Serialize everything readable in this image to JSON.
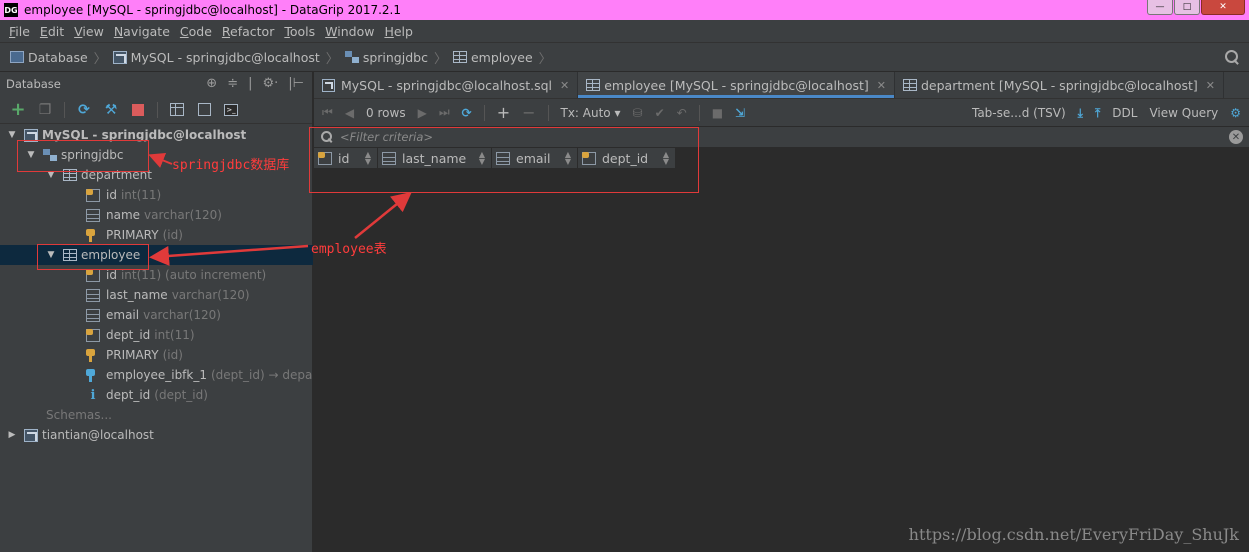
{
  "window": {
    "app_icon": "DG",
    "title": "employee [MySQL - springjdbc@localhost] - DataGrip 2017.2.1",
    "buttons": {
      "minimize": "—",
      "maximize": "□",
      "close": "✕"
    }
  },
  "menu": [
    {
      "key": "F",
      "rest": "ile"
    },
    {
      "key": "E",
      "rest": "dit"
    },
    {
      "key": "V",
      "rest": "iew"
    },
    {
      "key": "N",
      "rest": "avigate"
    },
    {
      "key": "C",
      "rest": "ode"
    },
    {
      "key": "R",
      "rest": "efactor"
    },
    {
      "key": "T",
      "rest": "ools"
    },
    {
      "key": "W",
      "rest": "indow"
    },
    {
      "key": "H",
      "rest": "elp"
    }
  ],
  "breadcrumb": [
    "Database",
    "MySQL - springjdbc@localhost",
    "springjdbc",
    "employee"
  ],
  "left_panel": {
    "title": "Database",
    "header_icons": [
      "⊕",
      "≑",
      "|",
      "⚙·",
      "|⊢"
    ],
    "tree": {
      "root": "MySQL - springjdbc@localhost",
      "schema": "springjdbc",
      "department": {
        "name": "department",
        "items": [
          {
            "name": "id",
            "type": "int(11)"
          },
          {
            "name": "name",
            "type": "varchar(120)"
          },
          {
            "name": "PRIMARY",
            "type": "(id)"
          }
        ]
      },
      "employee": {
        "name": "employee",
        "items": [
          {
            "name": "id",
            "type": "int(11) (auto increment)"
          },
          {
            "name": "last_name",
            "type": "varchar(120)"
          },
          {
            "name": "email",
            "type": "varchar(120)"
          },
          {
            "name": "dept_id",
            "type": "int(11)"
          },
          {
            "name": "PRIMARY",
            "type": "(id)"
          },
          {
            "name": "employee_ibfk_1",
            "type": "(dept_id) → departme"
          },
          {
            "name": "dept_id",
            "type": "(dept_id)"
          }
        ]
      },
      "schemas_label": "Schemas...",
      "other_connection": "tiantian@localhost"
    }
  },
  "tabs": [
    {
      "label": "MySQL - springjdbc@localhost.sql",
      "active": false
    },
    {
      "label": "employee [MySQL - springjdbc@localhost]",
      "active": true
    },
    {
      "label": "department [MySQL - springjdbc@localhost]",
      "active": false
    }
  ],
  "editor_toolbar": {
    "rows": "0 rows",
    "tx": "Tx: Auto",
    "format": "Tab-se...d (TSV)",
    "ddl": "DDL",
    "view_query": "View Query"
  },
  "filter": {
    "placeholder": "<Filter criteria>"
  },
  "grid": {
    "columns": [
      {
        "name": "id",
        "kind": "pk"
      },
      {
        "name": "last_name",
        "kind": "col"
      },
      {
        "name": "email",
        "kind": "col"
      },
      {
        "name": "dept_id",
        "kind": "fk"
      }
    ]
  },
  "annotations": {
    "schema_note": "springjdbc数据库",
    "table_note": "employee表"
  },
  "watermark": "https://blog.csdn.net/EveryFriDay_ShuJk",
  "colors": {
    "accent": "#4a88c7",
    "annotation_red": "#e03a3a",
    "selection": "#0d293e"
  }
}
